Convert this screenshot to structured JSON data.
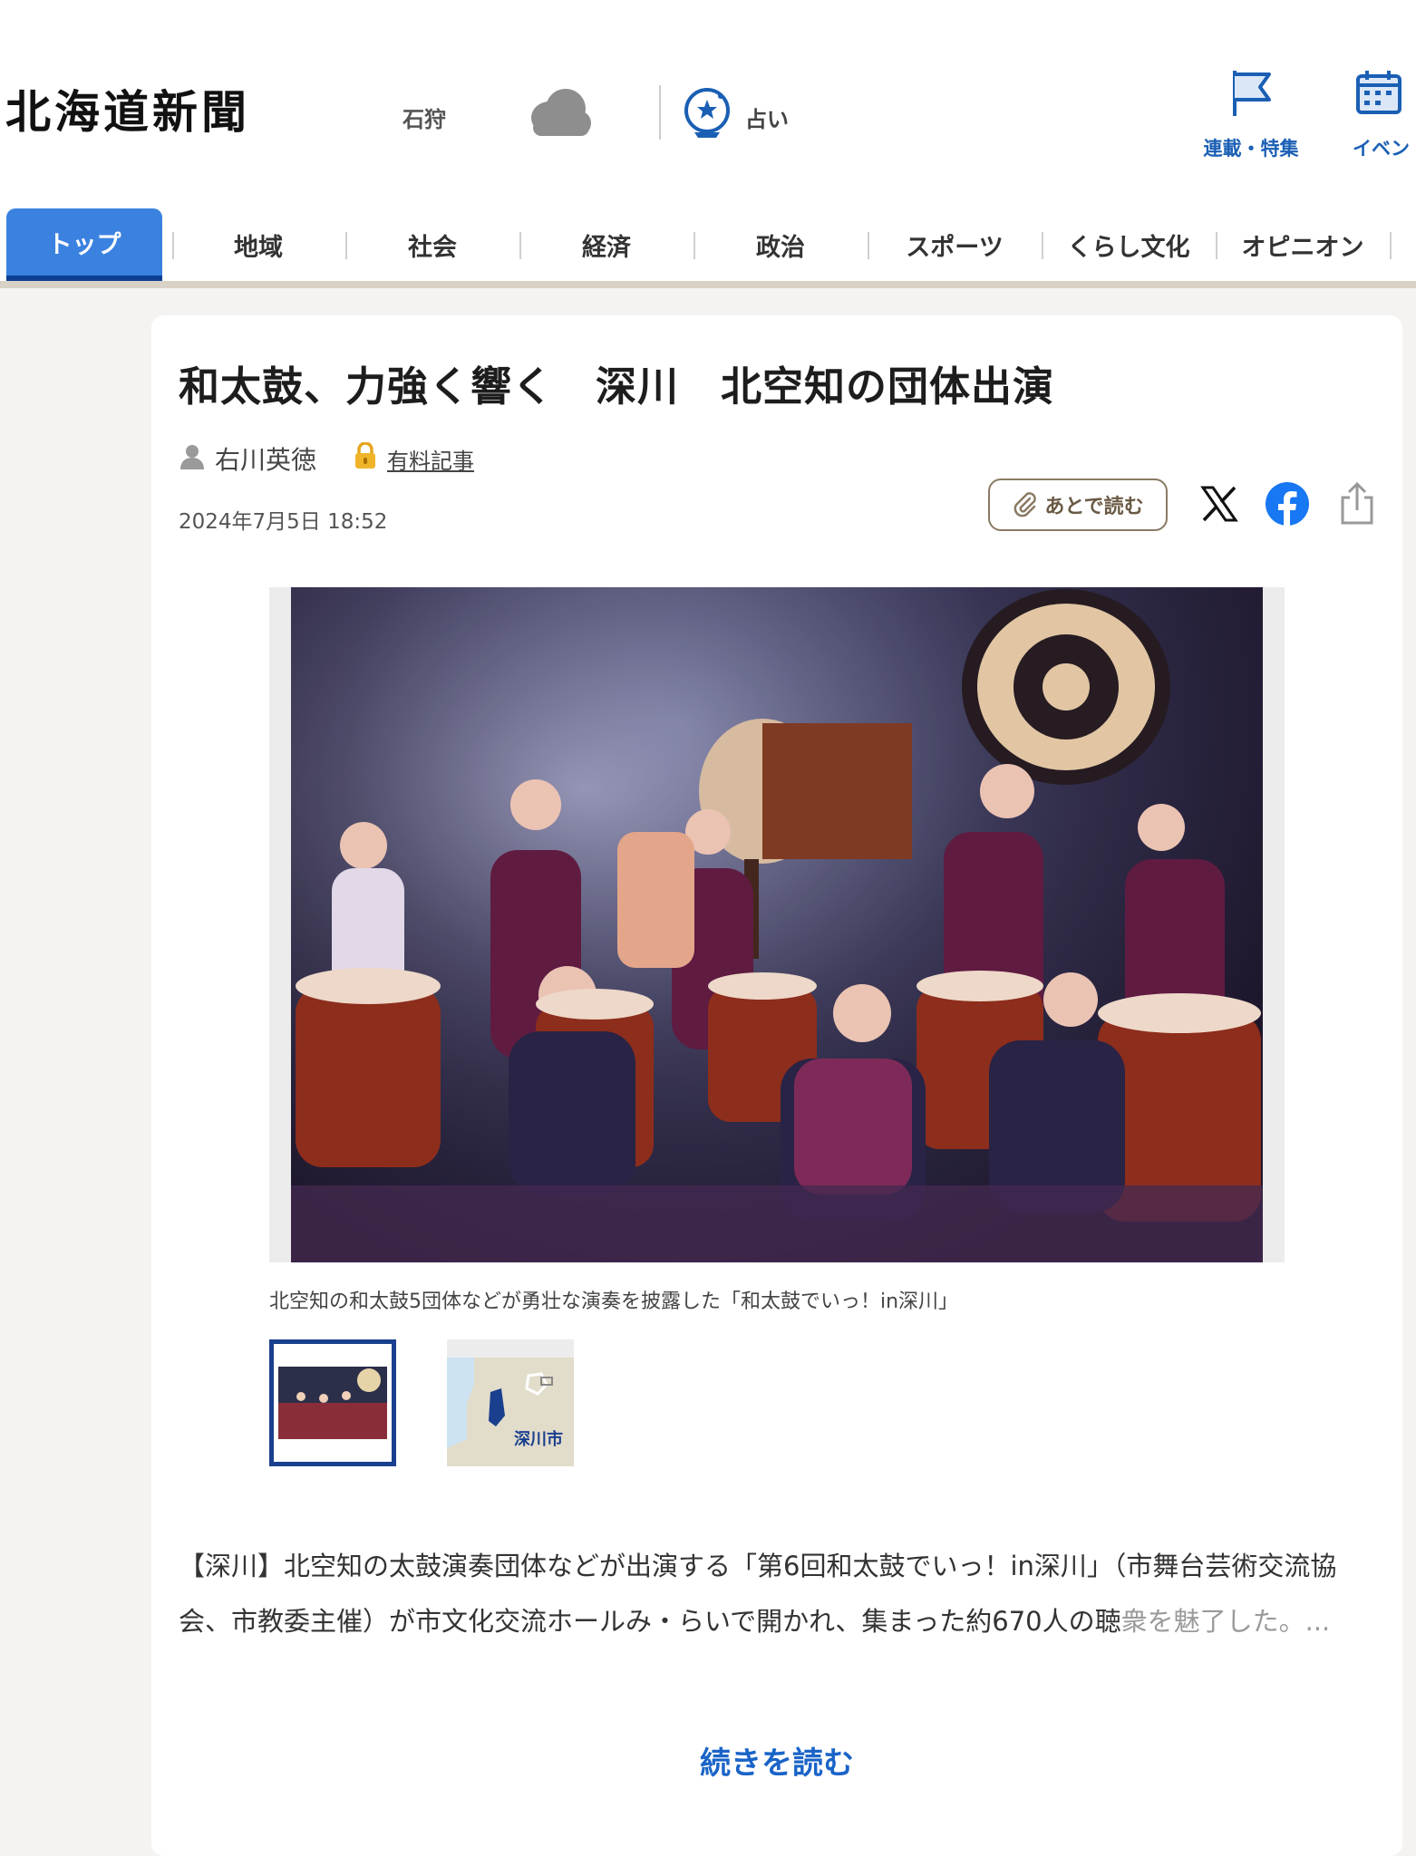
{
  "header": {
    "logo": "北海道新聞",
    "region": "石狩",
    "weather_icon": "cloud-icon",
    "fortune_label": "占い",
    "nav": [
      {
        "label": "連載・特集",
        "icon": "flag-icon"
      },
      {
        "label": "イベン",
        "icon": "calendar-icon"
      }
    ]
  },
  "tabs": [
    "トップ",
    "地域",
    "社会",
    "経済",
    "政治",
    "スポーツ",
    "くらし文化",
    "オピニオン"
  ],
  "article": {
    "title": "和太鼓、力強く響く　深川　北空知の団体出演",
    "author": "右川英徳",
    "paid_label": "有料記事",
    "date": "2024年7月5日 18:52",
    "read_later": "あとで読む",
    "caption": "北空知の和太鼓5団体などが勇壮な演奏を披露した「和太鼓でいっ！in深川」",
    "map_label": "深川市",
    "lead_main": "【深川】北空知の太鼓演奏団体などが出演する「第6回和太鼓でいっ！in深川」（市舞台芸術交流協会、市教委主催）が市文化交流ホールみ・らいで開かれ、集まった約670人の聴",
    "lead_fade": "衆を魅了した。...",
    "read_more": "続きを読む"
  },
  "colors": {
    "accent": "#3b82e0",
    "link": "#1a64c8",
    "facebook": "#1877f2"
  }
}
